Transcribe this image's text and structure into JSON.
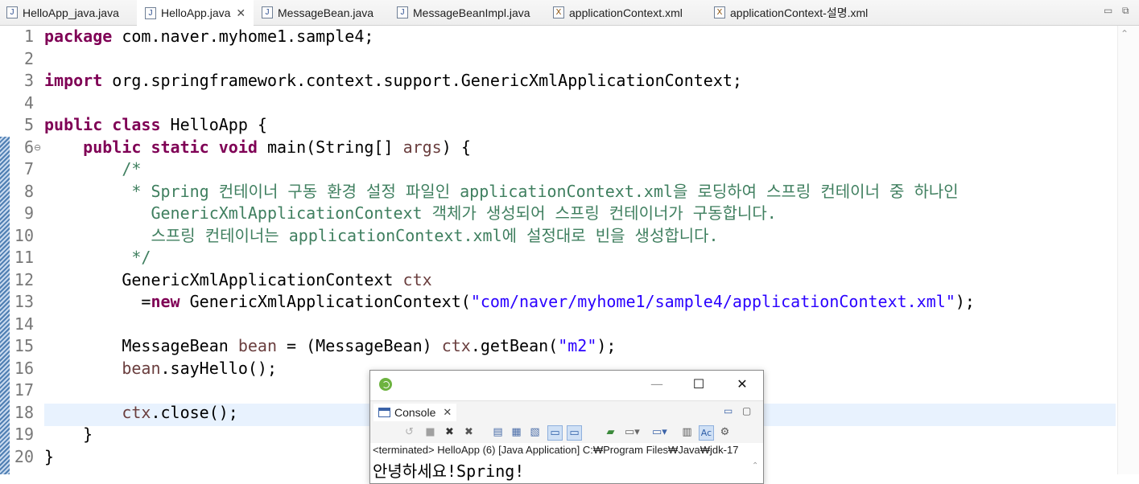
{
  "tabs": [
    {
      "label": "HelloApp_java.java",
      "icon": "java-file-icon",
      "active": false
    },
    {
      "label": "HelloApp.java",
      "icon": "java-file-icon",
      "active": true
    },
    {
      "label": "MessageBean.java",
      "icon": "java-file-icon",
      "active": false
    },
    {
      "label": "MessageBeanImpl.java",
      "icon": "java-file-icon",
      "active": false
    },
    {
      "label": "applicationContext.xml",
      "icon": "xml-file-icon",
      "active": false
    },
    {
      "label": "applicationContext-설명.xml",
      "icon": "xml-file-icon",
      "active": false
    }
  ],
  "editor": {
    "current_line": 18,
    "lines": [
      {
        "n": "1",
        "tokens": [
          {
            "t": "package",
            "c": "kw"
          },
          {
            "t": " com.naver.myhome1.sample4;",
            "c": ""
          }
        ]
      },
      {
        "n": "2",
        "tokens": []
      },
      {
        "n": "3",
        "tokens": [
          {
            "t": "import",
            "c": "kw"
          },
          {
            "t": " org.springframework.context.support.GenericXmlApplicationContext;",
            "c": ""
          }
        ]
      },
      {
        "n": "4",
        "tokens": []
      },
      {
        "n": "5",
        "tokens": [
          {
            "t": "public",
            "c": "kw"
          },
          {
            "t": " ",
            "c": ""
          },
          {
            "t": "class",
            "c": "kw"
          },
          {
            "t": " HelloApp {",
            "c": ""
          }
        ]
      },
      {
        "n": "6",
        "fold": "⊖",
        "tokens": [
          {
            "t": "    ",
            "c": ""
          },
          {
            "t": "public",
            "c": "kw"
          },
          {
            "t": " ",
            "c": ""
          },
          {
            "t": "static",
            "c": "kw"
          },
          {
            "t": " ",
            "c": ""
          },
          {
            "t": "void",
            "c": "kw"
          },
          {
            "t": " main(String[] ",
            "c": ""
          },
          {
            "t": "args",
            "c": "fld"
          },
          {
            "t": ") {",
            "c": ""
          }
        ]
      },
      {
        "n": "7",
        "tokens": [
          {
            "t": "        /*",
            "c": "cm"
          }
        ]
      },
      {
        "n": "8",
        "tokens": [
          {
            "t": "         * Spring 컨테이너 구동 환경 설정 파일인 applicationContext.xml을 로딩하여 스프링 컨테이너 중 하나인",
            "c": "cm"
          }
        ]
      },
      {
        "n": "9",
        "tokens": [
          {
            "t": "           GenericXmlApplicationContext 객체가 생성되어 스프링 컨테이너가 구동합니다.",
            "c": "cm"
          }
        ]
      },
      {
        "n": "10",
        "tokens": [
          {
            "t": "           스프링 컨테이너는 applicationContext.xml에 설정대로 빈을 생성합니다.",
            "c": "cm"
          }
        ]
      },
      {
        "n": "11",
        "tokens": [
          {
            "t": "         */",
            "c": "cm"
          }
        ]
      },
      {
        "n": "12",
        "tokens": [
          {
            "t": "        GenericXmlApplicationContext ",
            "c": ""
          },
          {
            "t": "ctx",
            "c": "fld"
          }
        ]
      },
      {
        "n": "13",
        "tokens": [
          {
            "t": "          =",
            "c": ""
          },
          {
            "t": "new",
            "c": "kw"
          },
          {
            "t": " GenericXmlApplicationContext(",
            "c": ""
          },
          {
            "t": "\"com/naver/myhome1/sample4/applicationContext.xml\"",
            "c": "str"
          },
          {
            "t": ");",
            "c": ""
          }
        ]
      },
      {
        "n": "14",
        "tokens": []
      },
      {
        "n": "15",
        "tokens": [
          {
            "t": "        MessageBean ",
            "c": ""
          },
          {
            "t": "bean",
            "c": "fld"
          },
          {
            "t": " = (MessageBean) ",
            "c": ""
          },
          {
            "t": "ctx",
            "c": "fld"
          },
          {
            "t": ".getBean(",
            "c": ""
          },
          {
            "t": "\"m2\"",
            "c": "str"
          },
          {
            "t": ");",
            "c": ""
          }
        ]
      },
      {
        "n": "16",
        "tokens": [
          {
            "t": "        ",
            "c": ""
          },
          {
            "t": "bean",
            "c": "fld"
          },
          {
            "t": ".sayHello();",
            "c": ""
          }
        ]
      },
      {
        "n": "17",
        "tokens": []
      },
      {
        "n": "18",
        "tokens": [
          {
            "t": "        ",
            "c": ""
          },
          {
            "t": "ctx",
            "c": "fld"
          },
          {
            "t": ".close();",
            "c": ""
          }
        ]
      },
      {
        "n": "19",
        "tokens": [
          {
            "t": "    }",
            "c": ""
          }
        ]
      },
      {
        "n": "20",
        "tokens": [
          {
            "t": "}",
            "c": ""
          }
        ]
      }
    ]
  },
  "console": {
    "window_buttons": {
      "minimize": "—",
      "maximize": "☐",
      "close": "✕"
    },
    "tab_label": "Console",
    "tab_close": "✕",
    "view_controls": {
      "minimize": "▭",
      "maximize": "▢"
    },
    "toolbar_icons": [
      "remove-launch-icon",
      "terminate-icon",
      "remove-all-icon",
      "remove-all-terminated-icon",
      "scroll-lock-icon",
      "clear-console-icon",
      "show-on-stdout-icon",
      "show-on-stderr-icon",
      "pin-console-icon",
      "display-console-icon",
      "open-console-icon",
      "copy-icon",
      "word-wrap-icon",
      "settings-icon"
    ],
    "status": "<terminated> HelloApp (6) [Java Application] C:₩Program Files₩Java₩jdk-17",
    "output": "안녕하세요!Spring!"
  },
  "colors": {
    "keyword": "#7f0055",
    "string": "#2a00ff",
    "comment": "#3f7f5f",
    "field": "#6a3e3e",
    "current_line": "#e8f2fe"
  }
}
